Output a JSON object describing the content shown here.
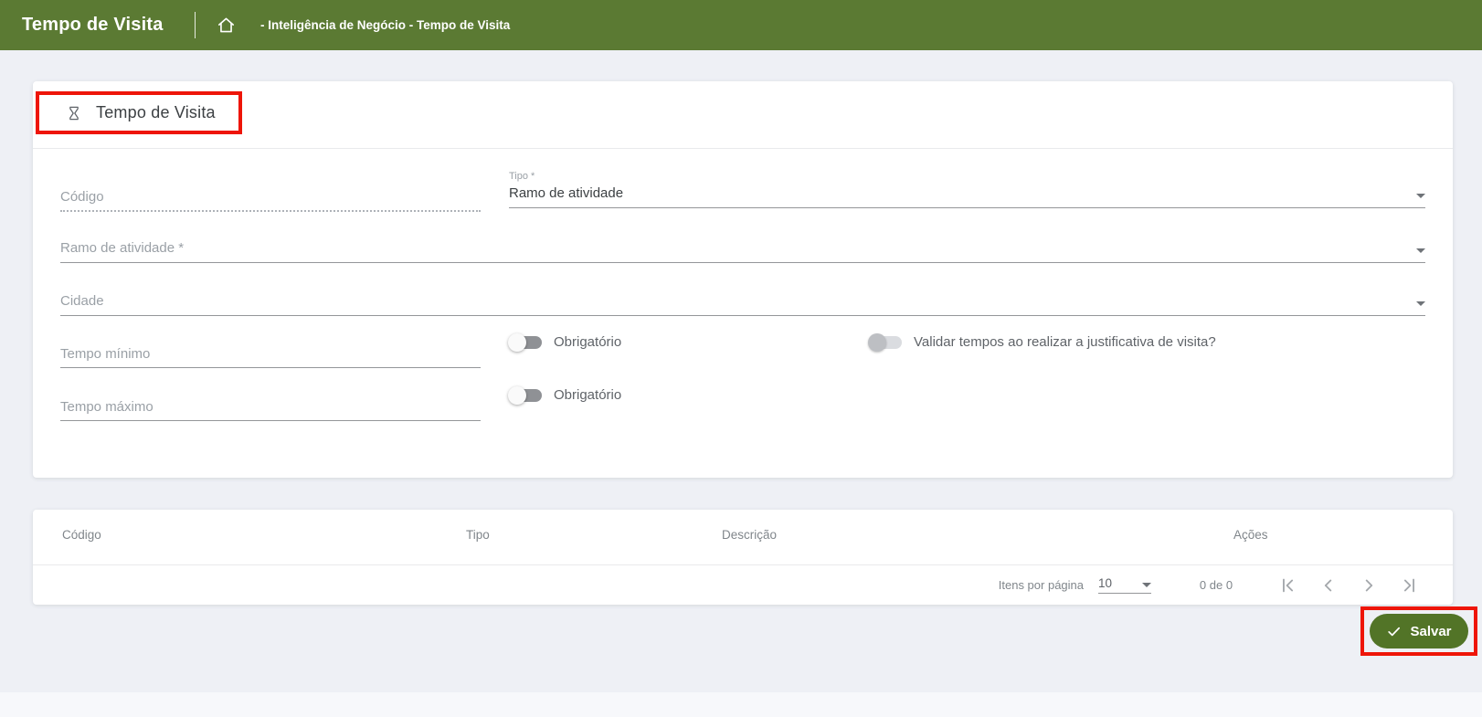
{
  "colors": {
    "header_green": "#5b7a33",
    "button_green": "#527427",
    "annotation_red": "#ee1508",
    "background": "#eef0f5"
  },
  "header": {
    "title": "Tempo de Visita",
    "breadcrumb": "- Inteligência de Negócio - Tempo de Visita",
    "home_icon": "home-icon"
  },
  "form": {
    "section_title": "Tempo de Visita",
    "section_icon": "hourglass-icon",
    "codigo_placeholder": "Código",
    "codigo_value": "",
    "tipo_label": "Tipo *",
    "tipo_value": "Ramo de atividade",
    "ramo_placeholder": "Ramo de atividade *",
    "ramo_value": "",
    "cidade_placeholder": "Cidade",
    "cidade_value": "",
    "tempo_minimo_placeholder": "Tempo mínimo",
    "tempo_minimo_value": "",
    "tempo_maximo_placeholder": "Tempo máximo",
    "tempo_maximo_value": "",
    "obrigatorio_min_label": "Obrigatório",
    "obrigatorio_max_label": "Obrigatório",
    "validar_label": "Validar tempos ao realizar a justificativa de visita?",
    "toggle_states": {
      "obrigatorio_min": "off",
      "obrigatorio_max": "off",
      "validar": "off"
    }
  },
  "table": {
    "columns": [
      "Código",
      "Tipo",
      "Descrição",
      "Ações"
    ],
    "rows": [],
    "paginator": {
      "items_per_page_label": "Itens por página",
      "items_per_page": "10",
      "range": "0 de 0"
    }
  },
  "actions": {
    "save": "Salvar"
  }
}
